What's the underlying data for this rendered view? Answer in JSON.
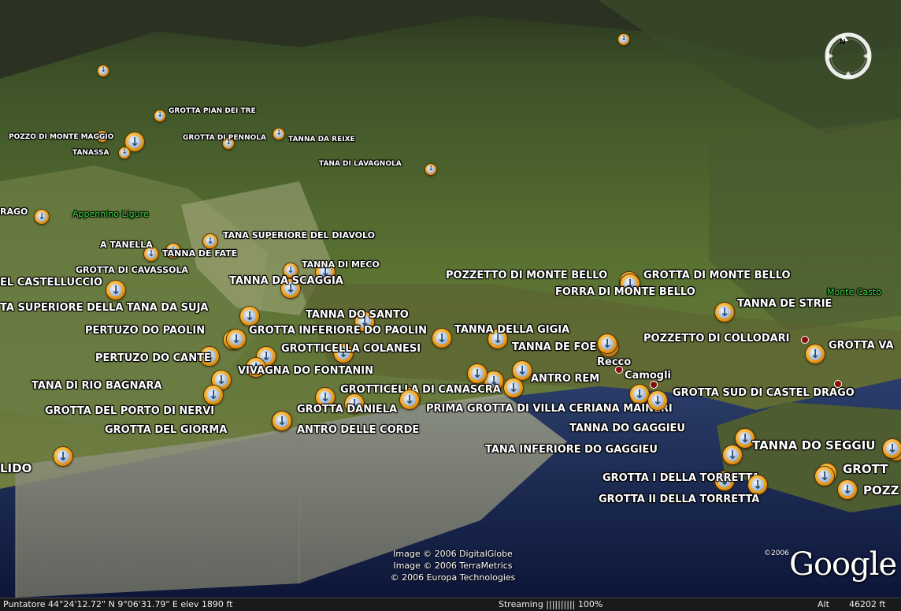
{
  "placemarks": [
    {
      "label": "GROTTA PIAN DEI TRE",
      "size": 1
    },
    {
      "label": "POZZO DI MONTE MAGGIO",
      "size": 1
    },
    {
      "label": "TANASSA",
      "size": 1
    },
    {
      "label": "GROTTA DI PENNOLA",
      "size": 1
    },
    {
      "label": "TANNA DA REIXE",
      "size": 1
    },
    {
      "label": "TANA DI LAVAGNOLA",
      "size": 1
    },
    {
      "label": "RAGO",
      "size": 2
    },
    {
      "label": "A TANELLA",
      "size": 2
    },
    {
      "label": "TANNA DE FATE",
      "size": 2
    },
    {
      "label": "TANA SUPERIORE DEL DIAVOLO",
      "size": 2
    },
    {
      "label": "GROTTA DI CAVASSOLA",
      "size": 2
    },
    {
      "label": "TANNA DI MECO",
      "size": 2
    },
    {
      "label": "TANNA DA SCAGGIA",
      "size": 3
    },
    {
      "label": "EL CASTELLUCCIO",
      "size": 3
    },
    {
      "label": "TA SUPERIORE DELLA TANA DA SUJA",
      "size": 3
    },
    {
      "label": "TANNA DO SANTO",
      "size": 3
    },
    {
      "label": "PERTUZO DO PAOLIN",
      "size": 3
    },
    {
      "label": "GROTTA INFERIORE DO PAOLIN",
      "size": 3
    },
    {
      "label": "TANNA DELLA GIGIA",
      "size": 3
    },
    {
      "label": "GROTTICELLA COLANESI",
      "size": 3
    },
    {
      "label": "TANNA DE FOE",
      "size": 3
    },
    {
      "label": "PERTUZO DO CANTE",
      "size": 3
    },
    {
      "label": "VIVAGNA DO FONTANIN",
      "size": 3
    },
    {
      "label": "TANA DI RIO BAGNARA",
      "size": 3
    },
    {
      "label": "ANTRO REM",
      "size": 3
    },
    {
      "label": "GROTTICELLA DI CANASCRA",
      "size": 3
    },
    {
      "label": "GROTTA DEL PORTO DI NERVI",
      "size": 3
    },
    {
      "label": "GROTTA DANIELA",
      "size": 3
    },
    {
      "label": "PRIMA GROTTA DI VILLA CERIANA MAINERI",
      "size": 3
    },
    {
      "label": "GROTTA DEL GIORMA",
      "size": 3
    },
    {
      "label": "ANTRO DELLE CORDE",
      "size": 3
    },
    {
      "label": "LIDO",
      "size": 4
    },
    {
      "label": "POZZETTO DI MONTE BELLO",
      "size": 3
    },
    {
      "label": "GROTTA DI MONTE BELLO",
      "size": 3
    },
    {
      "label": "FORRA DI MONTE BELLO",
      "size": 3
    },
    {
      "label": "TANNA DE STRIE",
      "size": 3
    },
    {
      "label": "POZZETTO DI COLLODARI",
      "size": 3
    },
    {
      "label": "GROTTA VA",
      "size": 3
    },
    {
      "label": "GROTTA SUD DI CASTEL DRAGO",
      "size": 3
    },
    {
      "label": "TANNA DO GAGGIEU",
      "size": 3
    },
    {
      "label": "TANA  INFERIORE DO GAGGIEU",
      "size": 3
    },
    {
      "label": "TANNA DO SEGGIU",
      "size": 4
    },
    {
      "label": "GROTTA I DELLA TORRETTA",
      "size": 3
    },
    {
      "label": "GROTTA II DELLA TORRETTA",
      "size": 3
    },
    {
      "label": "GROTT",
      "size": 4
    },
    {
      "label": "POZZ",
      "size": 4
    }
  ],
  "places": [
    {
      "label": "Appennino Ligure",
      "style": "green"
    },
    {
      "label": "Monte Casto",
      "style": "green"
    },
    {
      "label": "Recco",
      "style": "town"
    },
    {
      "label": "Camogli",
      "style": "town"
    }
  ],
  "copyright": [
    "Image © 2006 DigitalGlobe",
    "Image © 2006 TerraMetrics",
    "© 2006 Europa Technologies"
  ],
  "logo": {
    "year": "©2006",
    "word": "Google"
  },
  "status": {
    "pointer": "Puntatore 44°24'12.72\" N   9°06'31.79\"  E    elev  1890 ft",
    "streaming": "Streaming |||||||||| 100%",
    "alt_label": "Alt",
    "alt_value": "46202 ft"
  },
  "colors": {
    "forest": "#4f6a2c",
    "forest_dark": "#2f4220",
    "sea": "#1a2450",
    "coast_gray": "#8c8e7e",
    "sky_band": "#3c4a2a",
    "marker": "#f0a21c"
  }
}
